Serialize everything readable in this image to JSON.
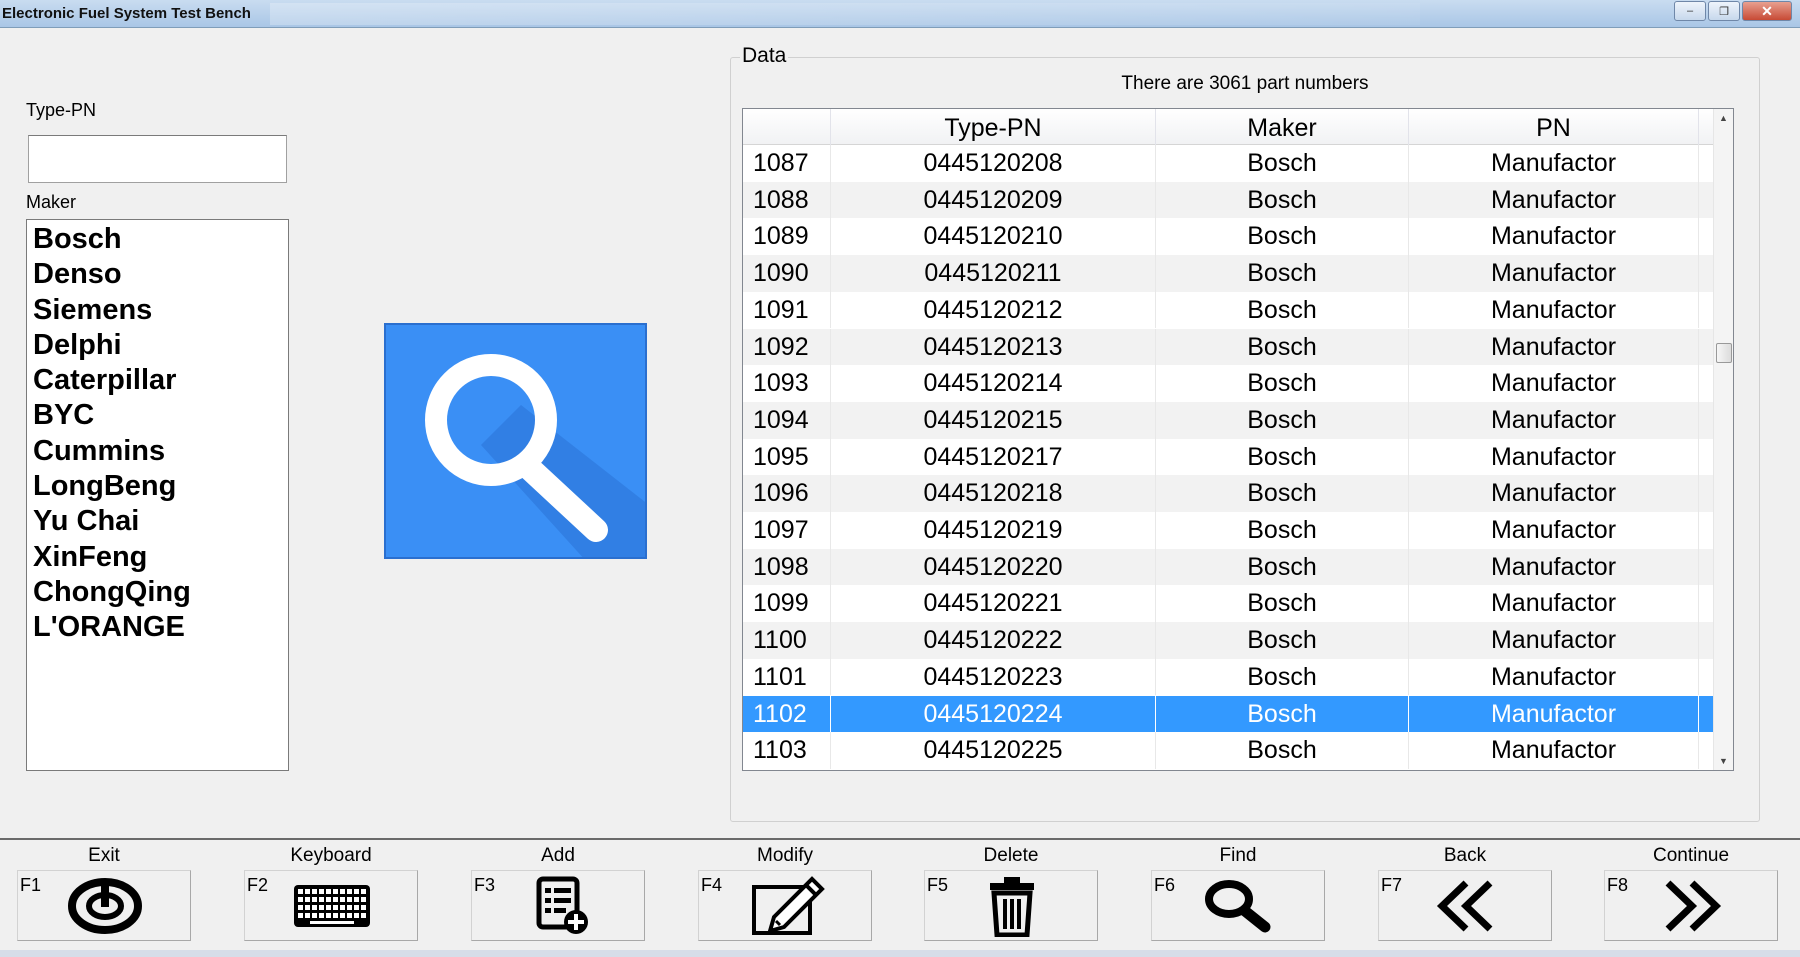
{
  "window": {
    "title": "Electronic Fuel System Test Bench",
    "min_glyph": "–",
    "max_glyph": "❐",
    "close_glyph": "✕"
  },
  "left": {
    "typepn_label": "Type-PN",
    "typepn_value": "",
    "maker_label": "Maker",
    "makers": [
      "Bosch",
      "Denso",
      "Siemens",
      "Delphi",
      "Caterpillar",
      "BYC",
      "Cummins",
      "LongBeng",
      "Yu Chai",
      "XinFeng",
      "ChongQing",
      "L'ORANGE"
    ]
  },
  "data": {
    "group_title": "Data",
    "count_text": "There are 3061 part numbers",
    "columns": [
      "",
      "Type-PN",
      "Maker",
      "PN"
    ],
    "rows": [
      [
        "1087",
        "0445120208",
        "Bosch",
        "Manufactor"
      ],
      [
        "1088",
        "0445120209",
        "Bosch",
        "Manufactor"
      ],
      [
        "1089",
        "0445120210",
        "Bosch",
        "Manufactor"
      ],
      [
        "1090",
        "0445120211",
        "Bosch",
        "Manufactor"
      ],
      [
        "1091",
        "0445120212",
        "Bosch",
        "Manufactor"
      ],
      [
        "1092",
        "0445120213",
        "Bosch",
        "Manufactor"
      ],
      [
        "1093",
        "0445120214",
        "Bosch",
        "Manufactor"
      ],
      [
        "1094",
        "0445120215",
        "Bosch",
        "Manufactor"
      ],
      [
        "1095",
        "0445120217",
        "Bosch",
        "Manufactor"
      ],
      [
        "1096",
        "0445120218",
        "Bosch",
        "Manufactor"
      ],
      [
        "1097",
        "0445120219",
        "Bosch",
        "Manufactor"
      ],
      [
        "1098",
        "0445120220",
        "Bosch",
        "Manufactor"
      ],
      [
        "1099",
        "0445120221",
        "Bosch",
        "Manufactor"
      ],
      [
        "1100",
        "0445120222",
        "Bosch",
        "Manufactor"
      ],
      [
        "1101",
        "0445120223",
        "Bosch",
        "Manufactor"
      ],
      [
        "1102",
        "0445120224",
        "Bosch",
        "Manufactor"
      ],
      [
        "1103",
        "0445120225",
        "Bosch",
        "Manufactor"
      ]
    ],
    "selected_row_number": "1102",
    "scroll_up_glyph": "▲",
    "scroll_down_glyph": "▼"
  },
  "toolbar": {
    "buttons": [
      {
        "label": "Exit",
        "key": "F1",
        "icon": "power-icon"
      },
      {
        "label": "Keyboard",
        "key": "F2",
        "icon": "keyboard-icon"
      },
      {
        "label": "Add",
        "key": "F3",
        "icon": "add-list-icon"
      },
      {
        "label": "Modify",
        "key": "F4",
        "icon": "edit-icon"
      },
      {
        "label": "Delete",
        "key": "F5",
        "icon": "trash-icon"
      },
      {
        "label": "Find",
        "key": "F6",
        "icon": "magnifier-icon"
      },
      {
        "label": "Back",
        "key": "F7",
        "icon": "double-chevron-left-icon"
      },
      {
        "label": "Continue",
        "key": "F8",
        "icon": "double-chevron-right-icon"
      }
    ]
  },
  "colors": {
    "accent_blue": "#3a8ff5",
    "selection": "#3399ff"
  }
}
